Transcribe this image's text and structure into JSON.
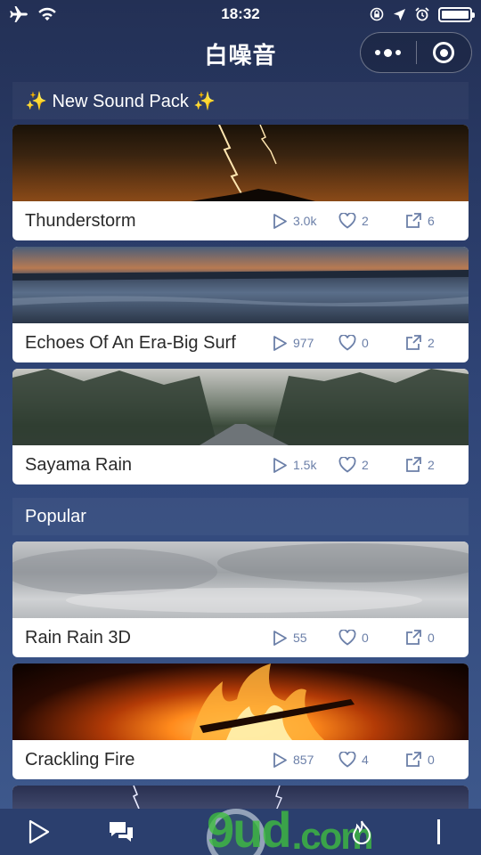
{
  "status_bar": {
    "time": "18:32",
    "left_icons": [
      "airplane-icon",
      "wifi-icon"
    ],
    "right_icons": [
      "rotation-lock-icon",
      "location-icon",
      "alarm-icon",
      "battery-icon"
    ]
  },
  "nav": {
    "title": "白噪音",
    "menu_icon": "more-dots-icon",
    "close_icon": "target-icon"
  },
  "sections": [
    {
      "label": "✨ New Sound Pack ✨"
    },
    {
      "label": "Popular"
    }
  ],
  "sounds": [
    {
      "name": "Thunderstorm",
      "plays": "3.0k",
      "likes": "2",
      "shares": "6",
      "image": "lightning-over-mountain"
    },
    {
      "name": "Echoes Of An Era-Big Surf",
      "plays": "977",
      "likes": "0",
      "shares": "2",
      "image": "sunset-sea-surf"
    },
    {
      "name": "Sayama Rain",
      "plays": "1.5k",
      "likes": "2",
      "shares": "2",
      "image": "misty-forest-road"
    },
    {
      "name": "Rain Rain 3D",
      "plays": "55",
      "likes": "0",
      "shares": "0",
      "image": "gray-clouds"
    },
    {
      "name": "Crackling Fire",
      "plays": "857",
      "likes": "4",
      "shares": "0",
      "image": "campfire-flames"
    }
  ],
  "tabbar": {
    "items": [
      "play-icon",
      "chat-icon",
      "fire-icon"
    ]
  },
  "watermark": {
    "text": "9ud",
    "suffix": ".com"
  },
  "colors": {
    "background": "#2f4476",
    "stat": "#6b7fa8",
    "tabbar": "#2b3f6e"
  }
}
